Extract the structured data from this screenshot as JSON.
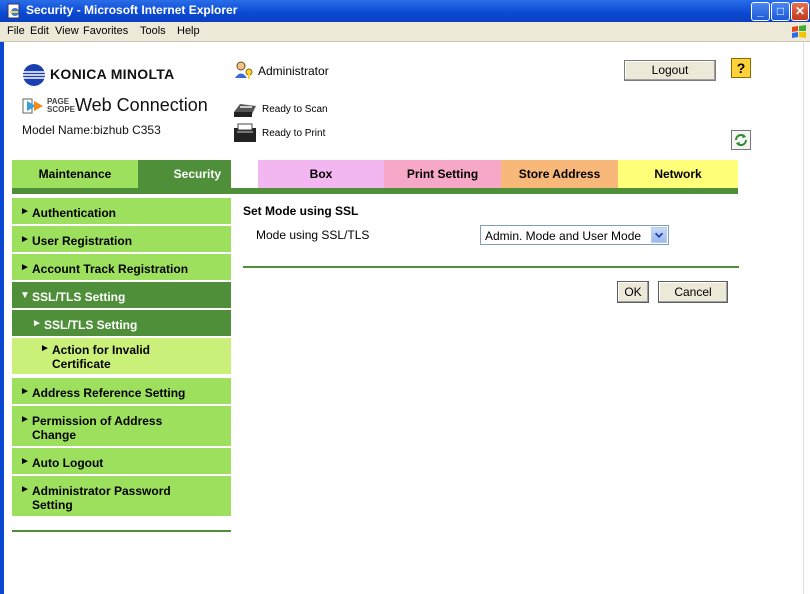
{
  "window": {
    "title": "Security - Microsoft Internet Explorer"
  },
  "menu": [
    "File",
    "Edit",
    "View",
    "Favorites",
    "Tools",
    "Help"
  ],
  "header": {
    "brand": "KONICA MINOLTA",
    "pagescope_top": "PAGE",
    "pagescope_bottom": "SCOPE",
    "product": "Web Connection",
    "model_label": "Model Name:",
    "model_value": "bizhub C353",
    "user": "Administrator",
    "logout_label": "Logout",
    "help_glyph": "?",
    "scan_status": "Ready to Scan",
    "print_status": "Ready to Print"
  },
  "tabs": [
    {
      "label": "Maintenance",
      "color": "#9de05e"
    },
    {
      "label": "Security",
      "color": "#4f8f3a",
      "active": true
    },
    {
      "label": "Box",
      "color": "#f2b6f0"
    },
    {
      "label": "Print Setting",
      "color": "#f7a8c8"
    },
    {
      "label": "Store Address",
      "color": "#f8b879"
    },
    {
      "label": "Network",
      "color": "#ffff7a"
    }
  ],
  "sidebar": {
    "items": [
      {
        "label": "Authentication"
      },
      {
        "label": "User Registration"
      },
      {
        "label": "Account Track Registration"
      },
      {
        "label": "SSL/TLS Setting",
        "expanded": true
      },
      {
        "label": "SSL/TLS Setting",
        "sub": true,
        "selected": true
      },
      {
        "label": "Action for Invalid Certificate",
        "sub": true
      },
      {
        "label": "Address Reference Setting"
      },
      {
        "label": "Permission of Address Change"
      },
      {
        "label": "Auto Logout"
      },
      {
        "label": "Administrator Password Setting"
      }
    ]
  },
  "content": {
    "heading": "Set Mode using SSL",
    "field_label": "Mode using SSL/TLS",
    "select_value": "Admin. Mode and User Mode",
    "ok_label": "OK",
    "cancel_label": "Cancel"
  },
  "icons": {
    "ie": "ie-page-icon",
    "admin": "admin-key-icon",
    "scanner": "scanner-icon",
    "printer": "printer-icon",
    "refresh": "refresh-icon",
    "help": "help-icon"
  }
}
